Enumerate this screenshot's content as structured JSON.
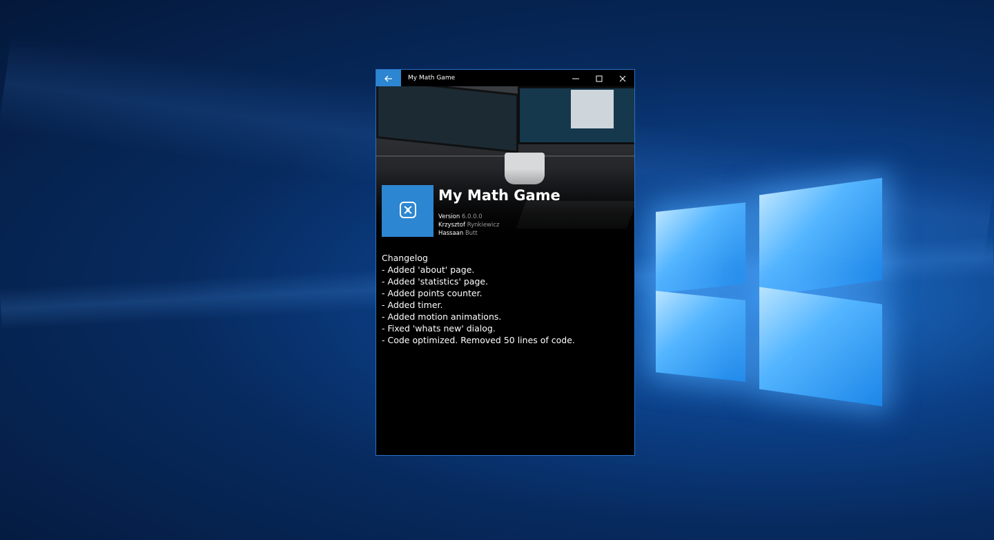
{
  "window": {
    "title": "My Math Game",
    "accent_color": "#2d86d1"
  },
  "title_bar": {
    "back_icon": "arrow-left-icon",
    "minimize_icon": "minimize-icon",
    "maximize_icon": "maximize-icon",
    "close_icon": "close-icon"
  },
  "hero": {
    "app_name": "My Math Game",
    "tile_icon": "app-logo-icon",
    "meta": [
      {
        "label": "Version",
        "value": "6.0.0.0"
      },
      {
        "label": "Krzysztof",
        "value": "Rynkiewicz"
      },
      {
        "label": "Hassaan",
        "value": "Butt"
      }
    ]
  },
  "changelog": {
    "heading": "Changelog",
    "items": [
      "- Added 'about' page.",
      "- Added 'statistics' page.",
      "- Added points counter.",
      "- Added timer.",
      "- Added motion animations.",
      "- Fixed 'whats new' dialog.",
      "- Code optimized. Removed 50 lines of code."
    ]
  }
}
